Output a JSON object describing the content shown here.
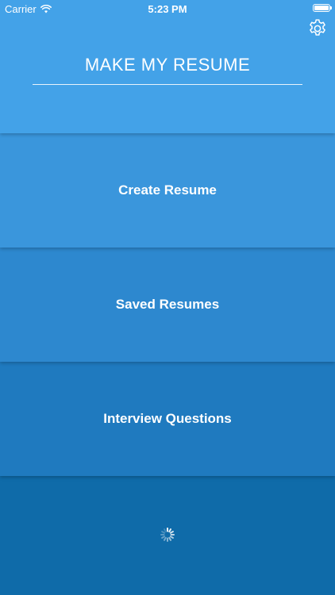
{
  "status_bar": {
    "carrier": "Carrier",
    "time": "5:23 PM",
    "icons": [
      "wifi-icon",
      "battery-icon"
    ]
  },
  "header": {
    "title": "MAKE MY RESUME",
    "settings_icon": "gear-icon"
  },
  "menu": {
    "items": [
      {
        "label": "Create Resume"
      },
      {
        "label": "Saved Resumes"
      },
      {
        "label": "Interview Questions"
      }
    ]
  },
  "loading_icon": "spinner-icon",
  "colors": {
    "header_bg": "#43a2e8",
    "panel_1": "#3a96dc",
    "panel_2": "#2d88cf",
    "panel_3": "#1f7abf",
    "panel_4": "#0f6ba9",
    "text": "#ffffff"
  }
}
